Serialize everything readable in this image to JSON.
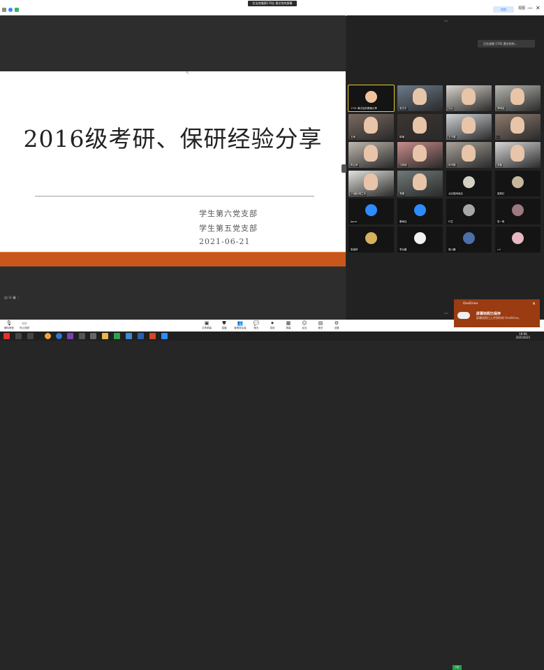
{
  "window": {
    "title": "拉法克隆图170业 黄文怡的屏幕",
    "view_button": "视图",
    "view_label": "视图",
    "min": "—",
    "max": "☐",
    "close": "✕"
  },
  "slide": {
    "title": "2016级考研、保研经验分享",
    "line1": "学生第六党支部",
    "line2": "学生第五党支部",
    "date": "2021-06-21"
  },
  "recording": {
    "label": "正在录制  1702 黄文怡的..."
  },
  "gallery": {
    "tiles": [
      {
        "name": "1702 黄文怡的屏幕分享",
        "kind": "avatar",
        "color": "#f1c39b",
        "active": true
      },
      {
        "name": "张艺宇",
        "kind": "photo",
        "color": "#6b7a8a"
      },
      {
        "name": "孙沁",
        "kind": "photo",
        "color": "#d9d4cc"
      },
      {
        "name": "李明浩",
        "kind": "photo",
        "color": "#b6b6b0"
      },
      {
        "name": "王雨",
        "kind": "photo",
        "color": "#7a6a60"
      },
      {
        "name": "陈琳",
        "kind": "photo",
        "color": "#3d3530"
      },
      {
        "name": "王子豪",
        "kind": "photo",
        "color": "#cfd3d6"
      },
      {
        "name": "...",
        "kind": "photo",
        "color": "#8d7a6e"
      },
      {
        "name": "陈云婷",
        "kind": "photo",
        "color": "#bfb8ae"
      },
      {
        "name": "汪家锦",
        "kind": "photo",
        "color": "#c98c8a"
      },
      {
        "name": "徐书丽",
        "kind": "photo",
        "color": "#a8a29a"
      },
      {
        "name": "张磊",
        "kind": "photo",
        "color": "#d7d7d7"
      },
      {
        "name": "17级杜明兰讯",
        "kind": "photo",
        "color": "#e2e2de"
      },
      {
        "name": "李娜",
        "kind": "photo",
        "color": "#6f7a78"
      },
      {
        "name": "北京智网商店",
        "kind": "avatar",
        "color": "#d4d0c4"
      },
      {
        "name": "梁秀红",
        "kind": "avatar",
        "color": "#c7b79a"
      },
      {
        "name": "Joyce",
        "kind": "avatar",
        "color": "#2d8cff"
      },
      {
        "name": "蕾雨佳",
        "kind": "avatar",
        "color": "#2d8cff"
      },
      {
        "name": "代芷",
        "kind": "avatar",
        "color": "#a7a7a7"
      },
      {
        "name": "张一帆",
        "kind": "avatar",
        "color": "#9c7a80"
      },
      {
        "name": "张婉婷",
        "kind": "avatar",
        "color": "#d4b25e"
      },
      {
        "name": "李允鹏",
        "kind": "avatar",
        "color": "#f2f2f2"
      },
      {
        "name": "周小鹏",
        "kind": "avatar",
        "color": "#4c6fa8"
      },
      {
        "name": "v.ll",
        "kind": "avatar",
        "color": "#e8b8c0"
      }
    ]
  },
  "controls": {
    "mute": "解除静音",
    "video": "停止视频",
    "security": "共享屏幕",
    "participants": "管理参会者",
    "share": "聊天",
    "chat": "录制",
    "record": "屏幕",
    "reactions": "反应",
    "more": "设置",
    "apps": "更多",
    "ai": "直播"
  },
  "toast": {
    "app": "OneDrive",
    "title": "屏幕快照已保存",
    "message": "屏幕快照已上传到你的 OneDrive。"
  },
  "taskbar": {
    "time": "19:06",
    "date": "2021/6/21",
    "tray_badge": "2月"
  }
}
